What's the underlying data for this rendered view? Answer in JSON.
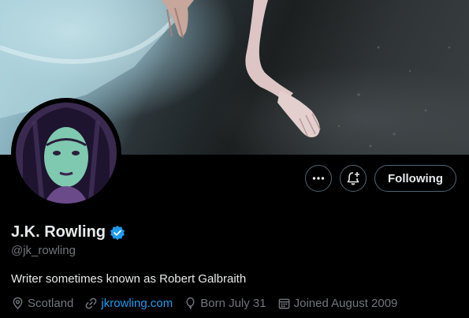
{
  "profile": {
    "name": "J.K. Rowling",
    "handle": "@jk_rowling",
    "bio": "Writer sometimes known as Robert Galbraith",
    "verified": true,
    "location": "Scotland",
    "website": "jkrowling.com",
    "born": "Born July 31",
    "joined": "Joined August 2009"
  },
  "actions": {
    "more_icon": "more-horizontal-icon",
    "notify_icon": "bell-plus-icon",
    "follow_label": "Following"
  },
  "colors": {
    "background": "#000000",
    "text_primary": "#e7e9ea",
    "text_secondary": "#71767b",
    "link": "#1d9bf0",
    "verified_badge": "#1d9bf0",
    "button_border": "#536471"
  }
}
